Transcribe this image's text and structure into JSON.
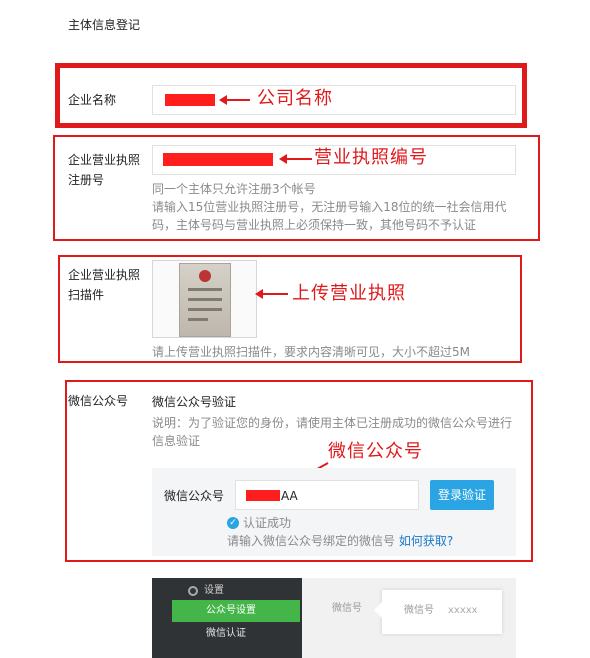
{
  "page": {
    "title": "主体信息登记"
  },
  "company": {
    "label": "企业名称",
    "annotation": "公司名称"
  },
  "license": {
    "label_line1": "企业营业执照",
    "label_line2": "注册号",
    "annotation": "营业执照编号",
    "help_line1": "同一个主体只允许注册3个帐号",
    "help_line2": "请输入15位营业执照注册号，无注册号输入18位的统一社会信用代",
    "help_line3": "码，主体号码与营业执照上必须保持一致，其他号码不予认证"
  },
  "scan": {
    "label_line1": "企业营业执照",
    "label_line2": "扫描件",
    "annotation": "上传营业执照",
    "help": "请上传营业执照扫描件，要求内容清晰可见，大小不超过5M"
  },
  "wechat": {
    "label": "微信公众号",
    "section_title": "微信公众号验证",
    "desc_line1": "说明：为了验证您的身份，请使用主体已注册成功的微信公众号进行",
    "desc_line2": "信息验证",
    "annotation": "微信公众号",
    "field_label": "微信公众号",
    "field_value_suffix": "AA",
    "login_button": "登录验证",
    "success_text": "认证成功",
    "hint_text": "请输入微信公众号绑定的微信号",
    "how_link": "如何获取?"
  },
  "preview": {
    "settings": "设置",
    "account_settings": "公众号设置",
    "wechat_auth": "微信认证",
    "wechat_id_label": "微信号",
    "card_label": "微信号",
    "card_value": "xxxxx"
  },
  "colors": {
    "annotation_red": "#e0191b",
    "redaction": "#ff1e1e",
    "button_blue": "#2aa4e2",
    "link_blue": "#1a77c9"
  }
}
